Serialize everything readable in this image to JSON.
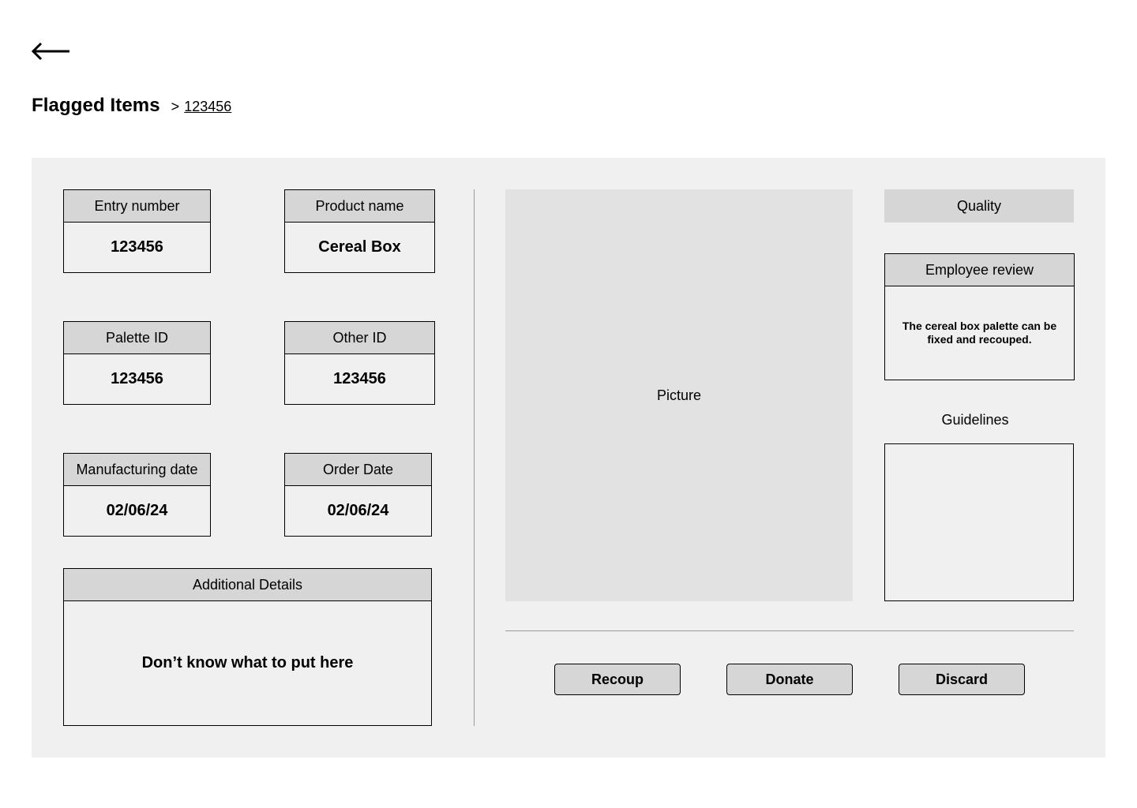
{
  "header": {
    "back_icon": "arrow-left-icon",
    "title": "Flagged Items",
    "breadcrumb_separator": ">",
    "breadcrumb_current": "123456"
  },
  "fields": {
    "entry_number": {
      "label": "Entry number",
      "value": "123456"
    },
    "product_name": {
      "label": "Product name",
      "value": "Cereal Box"
    },
    "palette_id": {
      "label": "Palette ID",
      "value": "123456"
    },
    "other_id": {
      "label": "Other ID",
      "value": "123456"
    },
    "manufacturing_date": {
      "label": "Manufacturing date",
      "value": "02/06/24"
    },
    "order_date": {
      "label": "Order Date",
      "value": "02/06/24"
    },
    "additional_details": {
      "label": "Additional Details",
      "value": "Don’t know what to put here"
    }
  },
  "picture": {
    "label": "Picture"
  },
  "quality": {
    "label": "Quality"
  },
  "employee_review": {
    "label": "Employee review",
    "text": "The cereal box palette can be fixed and recouped."
  },
  "guidelines": {
    "label": "Guidelines"
  },
  "actions": {
    "recoup": "Recoup",
    "donate": "Donate",
    "discard": "Discard"
  },
  "colors": {
    "panel_bg": "#f0f0f0",
    "header_bg": "#d6d6d6",
    "picture_bg": "#e2e2e2"
  }
}
